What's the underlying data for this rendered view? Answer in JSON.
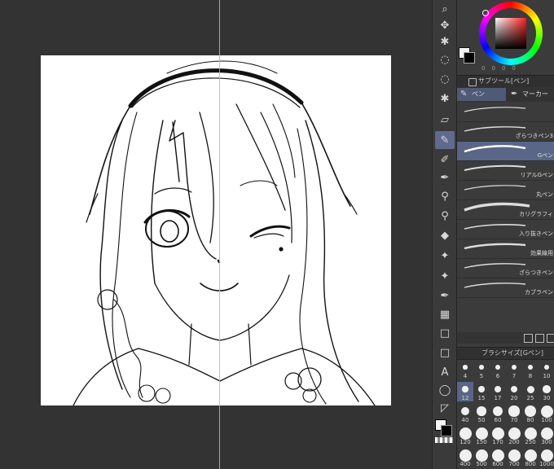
{
  "subtool_panel": {
    "title": "サブツール[ペン]",
    "tabs": [
      {
        "label": "ペン",
        "icon": "pen-icon"
      },
      {
        "label": "マーカー",
        "icon": "marker-icon"
      }
    ],
    "brushes": [
      {
        "name": "",
        "selected": false
      },
      {
        "name": "ざらつきペン3",
        "selected": false
      },
      {
        "name": "Gペン",
        "selected": true
      },
      {
        "name": "リアルGペン",
        "selected": false
      },
      {
        "name": "丸ペン",
        "selected": false
      },
      {
        "name": "カリグラフィ",
        "selected": false
      },
      {
        "name": "入り抜きペン",
        "selected": false
      },
      {
        "name": "効果線用",
        "selected": false
      },
      {
        "name": "ざらつきペン",
        "selected": false
      },
      {
        "name": "カブラペン",
        "selected": false
      }
    ]
  },
  "color_wheel": {
    "values": [
      "0",
      "0",
      "0",
      "0"
    ],
    "main_color": "#ff1e1e"
  },
  "brush_size_panel": {
    "title": "ブラシサイズ[Gペン]",
    "sizes": [
      "4",
      "5",
      "6",
      "7",
      "8",
      "10",
      "12",
      "15",
      "17",
      "20",
      "25",
      "30",
      "40",
      "50",
      "60",
      "70",
      "80",
      "100",
      "120",
      "150",
      "170",
      "200",
      "250",
      "300",
      "400",
      "500",
      "600",
      "700",
      "800",
      "1000"
    ],
    "selected": "12"
  },
  "tools": [
    {
      "name": "zoom-tool-icon",
      "glyph": "⌕"
    },
    {
      "name": "move-tool-icon",
      "glyph": "✥"
    },
    {
      "name": "magic-wand-tool-icon",
      "glyph": "✱"
    },
    {
      "name": "lasso-tool-icon",
      "glyph": "◌"
    },
    {
      "name": "eraser-tool-icon",
      "glyph": "▱"
    },
    {
      "name": "pen-tool-icon",
      "glyph": "✎"
    },
    {
      "name": "pencil-tool-icon",
      "glyph": "✐"
    },
    {
      "name": "brush-tool-icon",
      "glyph": "✒"
    },
    {
      "name": "airbrush-tool-icon",
      "glyph": "⚲"
    },
    {
      "name": "fill-tool-icon",
      "glyph": "◆"
    },
    {
      "name": "blend-tool-icon",
      "glyph": "✦"
    },
    {
      "name": "gradient-tool-icon",
      "glyph": "▦"
    },
    {
      "name": "figure-tool-icon",
      "glyph": "□"
    },
    {
      "name": "text-tool-icon",
      "glyph": "A"
    },
    {
      "name": "balloon-tool-icon",
      "glyph": "◯"
    },
    {
      "name": "ruler-tool-icon",
      "glyph": "◸"
    }
  ]
}
